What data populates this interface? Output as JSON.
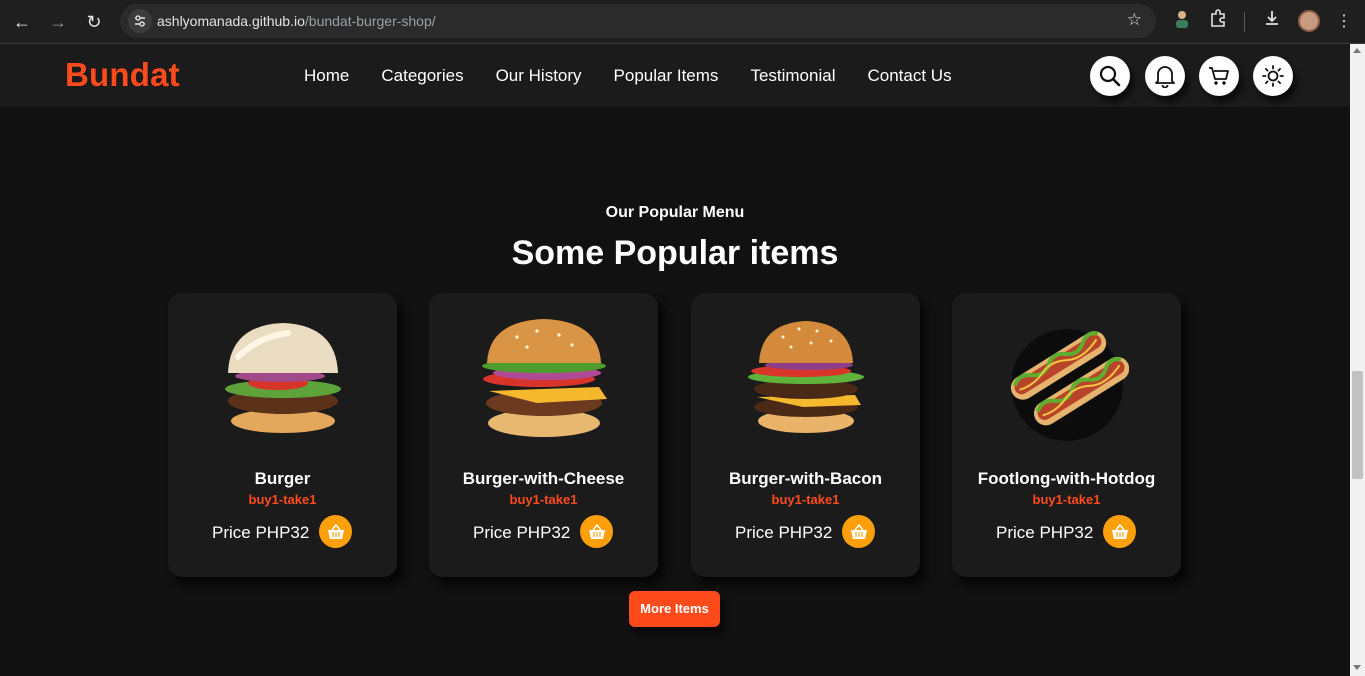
{
  "browser": {
    "back_icon": "back-arrow-icon",
    "url_host": "ashlyomanada.github.io",
    "url_path": "/bundat-burger-shop/"
  },
  "site": {
    "logo": "Bundat",
    "nav": [
      "Home",
      "Categories",
      "Our History",
      "Popular Items",
      "Testimonial",
      "Contact Us"
    ],
    "accent_color": "#ff4a1c",
    "cart_button_color": "#ff9f0a"
  },
  "section": {
    "subtitle": "Our Popular Menu",
    "title": "Some Popular items"
  },
  "items": [
    {
      "name": "Burger",
      "promo": "buy1-take1",
      "price": "Price PHP32"
    },
    {
      "name": "Burger-with-Cheese",
      "promo": "buy1-take1",
      "price": "Price PHP32"
    },
    {
      "name": "Burger-with-Bacon",
      "promo": "buy1-take1",
      "price": "Price PHP32"
    },
    {
      "name": "Footlong-with-Hotdog",
      "promo": "buy1-take1",
      "price": "Price PHP32"
    }
  ],
  "more_button": "More Items"
}
